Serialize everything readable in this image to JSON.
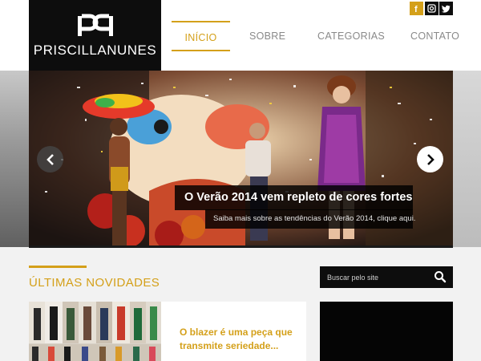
{
  "header": {
    "logo_text": "PRISCILLANUNES",
    "nav": [
      {
        "label": "INÍCIO",
        "active": true
      },
      {
        "label": "SOBRE",
        "active": false
      },
      {
        "label": "CATEGORIAS",
        "active": false
      },
      {
        "label": "CONTATO",
        "active": false
      }
    ],
    "social": [
      {
        "icon": "facebook-icon",
        "label": "f"
      },
      {
        "icon": "instagram-icon"
      },
      {
        "icon": "twitter-icon"
      }
    ]
  },
  "slider": {
    "title": "O Verão 2014 vem repleto de cores fortes",
    "subtitle": "Saiba mais sobre as tendências do Verão 2014, clique aqui.",
    "prev_icon": "chevron-left-icon",
    "next_icon": "chevron-right-icon"
  },
  "main": {
    "section_title": "ÚLTIMAS NOVIDADES",
    "post": {
      "title": "O blazer é uma peça que transmite seriedade..."
    }
  },
  "sidebar": {
    "search_placeholder": "Buscar pelo site",
    "search_icon": "search-icon"
  },
  "colors": {
    "accent": "#d4a01a",
    "dark": "#0d0d0d",
    "background": "#f2f2f2"
  }
}
